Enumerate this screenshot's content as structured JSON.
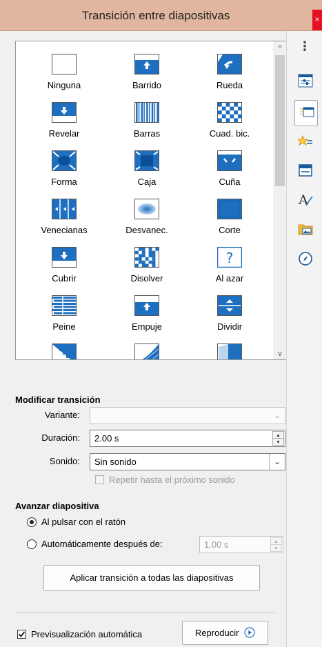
{
  "window": {
    "title": "Transición entre diapositivas",
    "close_glyph": "×"
  },
  "transitions": [
    {
      "label": "Ninguna",
      "icon": "none-icon"
    },
    {
      "label": "Barrido",
      "icon": "wipe-icon"
    },
    {
      "label": "Rueda",
      "icon": "wheel-icon"
    },
    {
      "label": "Revelar",
      "icon": "uncover-icon"
    },
    {
      "label": "Barras",
      "icon": "bars-icon"
    },
    {
      "label": "Cuad. bic.",
      "icon": "checkerboard-icon"
    },
    {
      "label": "Forma",
      "icon": "shape-icon"
    },
    {
      "label": "Caja",
      "icon": "box-icon"
    },
    {
      "label": "Cuña",
      "icon": "wedge-icon"
    },
    {
      "label": "Venecianas",
      "icon": "venetian-icon"
    },
    {
      "label": "Desvanec.",
      "icon": "fade-icon"
    },
    {
      "label": "Corte",
      "icon": "cut-icon"
    },
    {
      "label": "Cubrir",
      "icon": "cover-icon"
    },
    {
      "label": "Disolver",
      "icon": "dissolve-icon"
    },
    {
      "label": "Al azar",
      "icon": "random-icon"
    },
    {
      "label": "Peine",
      "icon": "comb-icon"
    },
    {
      "label": "Empuje",
      "icon": "push-icon"
    },
    {
      "label": "Dividir",
      "icon": "split-icon"
    },
    {
      "label": "",
      "icon": "diagonal-icon"
    },
    {
      "label": "",
      "icon": "fan-icon"
    },
    {
      "label": "",
      "icon": "cube-icon"
    }
  ],
  "gallery_scroll": {
    "up": "^",
    "down": "v"
  },
  "modify": {
    "title": "Modificar transición",
    "variant_label": "Variante:",
    "variant_value": "",
    "duration_label": "Duración:",
    "duration_value": "2.00 s",
    "sound_label": "Sonido:",
    "sound_value": "Sin sonido",
    "repeat_label": "Repetir hasta el próximo sonido"
  },
  "advance": {
    "title": "Avanzar diapositiva",
    "on_click_label": "Al pulsar con el ratón",
    "auto_label": "Automáticamente después de:",
    "auto_value": "1.00 s",
    "selected": "on_click"
  },
  "apply_all_label": "Aplicar transición a todas las diapositivas",
  "auto_preview_label": "Previsualización automática",
  "auto_preview_checked": true,
  "play_label": "Reproducir",
  "sidebar": {
    "menu_glyph": "⋮",
    "items": [
      "properties-icon",
      "slide-transition-icon",
      "animation-icon",
      "master-slides-icon",
      "styles-icon",
      "gallery-icon",
      "navigator-icon"
    ]
  }
}
